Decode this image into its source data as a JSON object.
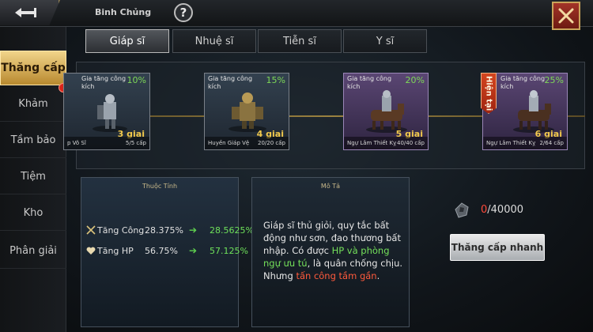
{
  "header": {
    "title": "Binh Chủng",
    "help_label": "?"
  },
  "sidebar": {
    "items": [
      {
        "label": "Thăng cấp"
      },
      {
        "label": "Khảm"
      },
      {
        "label": "Tầm bảo"
      },
      {
        "label": "Tiệm"
      },
      {
        "label": "Kho"
      },
      {
        "label": "Phân giải"
      }
    ]
  },
  "tabs": [
    {
      "label": "Giáp sĩ"
    },
    {
      "label": "Nhuệ sĩ"
    },
    {
      "label": "Tiễn sĩ"
    },
    {
      "label": "Y sĩ"
    }
  ],
  "stages": [
    {
      "desc": "Gia tăng công kích",
      "percent": "10%",
      "stage": "3 giai",
      "name": "p Võ Sĩ",
      "progress": "5/5 cấp",
      "rarity": "blue"
    },
    {
      "desc": "Gia tăng công kích",
      "percent": "15%",
      "stage": "4 giai",
      "name": "Huyền Giáp Vệ",
      "progress": "20/20 cấp",
      "rarity": "blue"
    },
    {
      "desc": "Gia tăng công kích",
      "percent": "20%",
      "stage": "5 giai",
      "name": "Ngự Lâm Thiết Kỵ",
      "progress": "40/40 cấp",
      "rarity": "purple"
    },
    {
      "desc": "Gia tăng công kích",
      "percent": "25%",
      "stage": "6 giai",
      "name": "Ngự Lâm Thiết Kỵ",
      "progress": "2/64 cấp",
      "rarity": "purple"
    }
  ],
  "current_label": "Hiện tại",
  "stats": {
    "title": "Thuộc Tính",
    "rows": [
      {
        "label": "Tăng Công",
        "current": "28.375%",
        "next": "28.5625%",
        "icon": "crossed-swords-icon"
      },
      {
        "label": "Tăng HP",
        "current": "56.75%",
        "next": "57.125%",
        "icon": "heart-icon"
      }
    ]
  },
  "description": {
    "title": "Mô Tả",
    "text_1": "Giáp sĩ thủ giỏi, quy tắc bất động như sơn, đao thương bất nhập. Có được ",
    "highlight_green": "HP và phòng ngự ưu tú",
    "text_2": ", là quân chống chịu. Nhưng ",
    "highlight_red": "tấn công tầm gần",
    "text_3": "."
  },
  "cost": {
    "have": "0",
    "need": "/40000",
    "icon": "ore-icon"
  },
  "upgrade_button": "Thăng cấp nhanh",
  "colors": {
    "accent_gold": "#f1d48a",
    "bonus_green": "#6ee05a",
    "warning_red": "#ff4a3a"
  }
}
